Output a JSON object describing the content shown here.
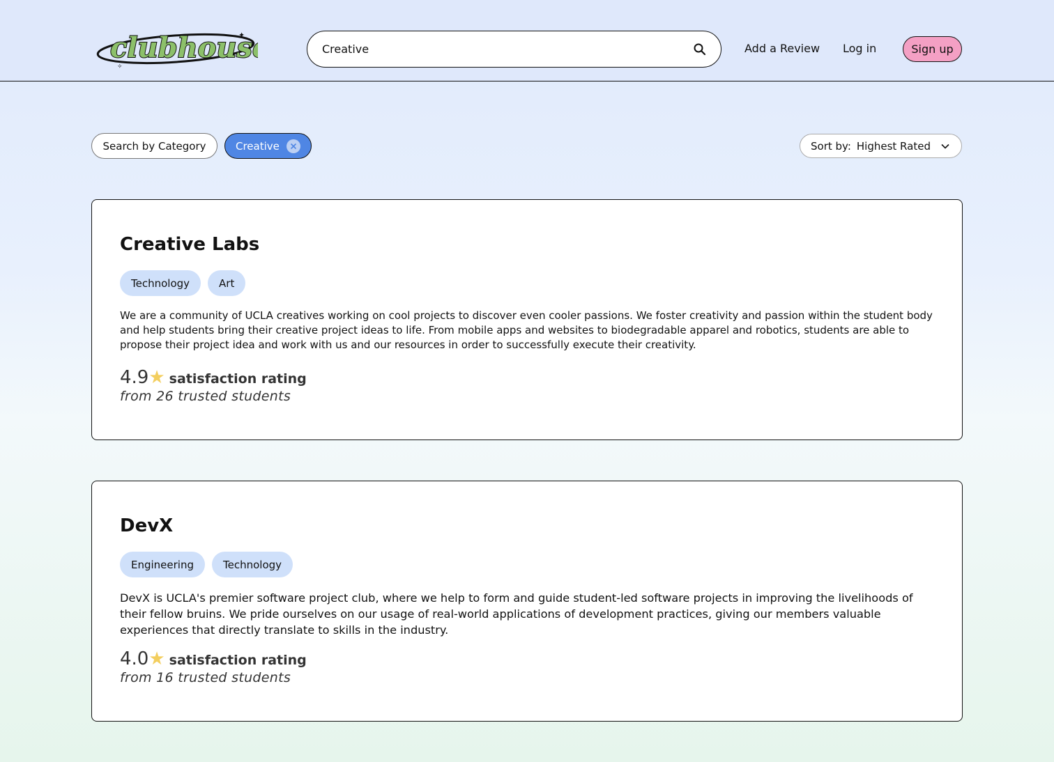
{
  "header": {
    "logo_text": "clubhouse",
    "search": {
      "value": "Creative",
      "placeholder": ""
    },
    "nav": {
      "add_review": "Add a Review",
      "login": "Log in",
      "signup": "Sign up"
    }
  },
  "filters": {
    "category_button": "Search by Category",
    "active_filter": "Creative",
    "sort_label": "Sort by:",
    "sort_value": "Highest Rated"
  },
  "clubs": [
    {
      "name": "Creative Labs",
      "tags": [
        "Technology",
        "Art"
      ],
      "description": "We are a community of UCLA creatives working on cool projects to discover even cooler passions. We foster creativity and passion within the student body and help students bring their creative project ideas to life. From mobile apps and websites to biodegradable apparel and robotics, students are able to propose their project idea and work with us and our resources in order to successfully execute their creativity.",
      "rating": "4.9",
      "rating_label": "satisfaction rating",
      "rating_sub": "from 26 trusted students"
    },
    {
      "name": "DevX",
      "tags": [
        "Engineering",
        "Technology"
      ],
      "description": "DevX is UCLA's premier software project club, where we help to form and guide student-led software projects in improving the livelihoods of their fellow bruins. We pride ourselves on our usage of real-world applications of development practices, giving our members valuable experiences that directly translate to skills in the industry.",
      "rating": "4.0",
      "rating_label": "satisfaction rating",
      "rating_sub": "from 16 trusted students"
    }
  ],
  "colors": {
    "signup_bg": "#f4a0c4",
    "active_chip": "#4f86e4",
    "tag_bg": "#cfe0fa",
    "star": "#f3ce5e",
    "logo_green": "#8cc06a"
  },
  "icons": {
    "search": "search-icon",
    "close": "close-icon",
    "sort": "chevron-down-icon",
    "rating": "star-icon"
  }
}
